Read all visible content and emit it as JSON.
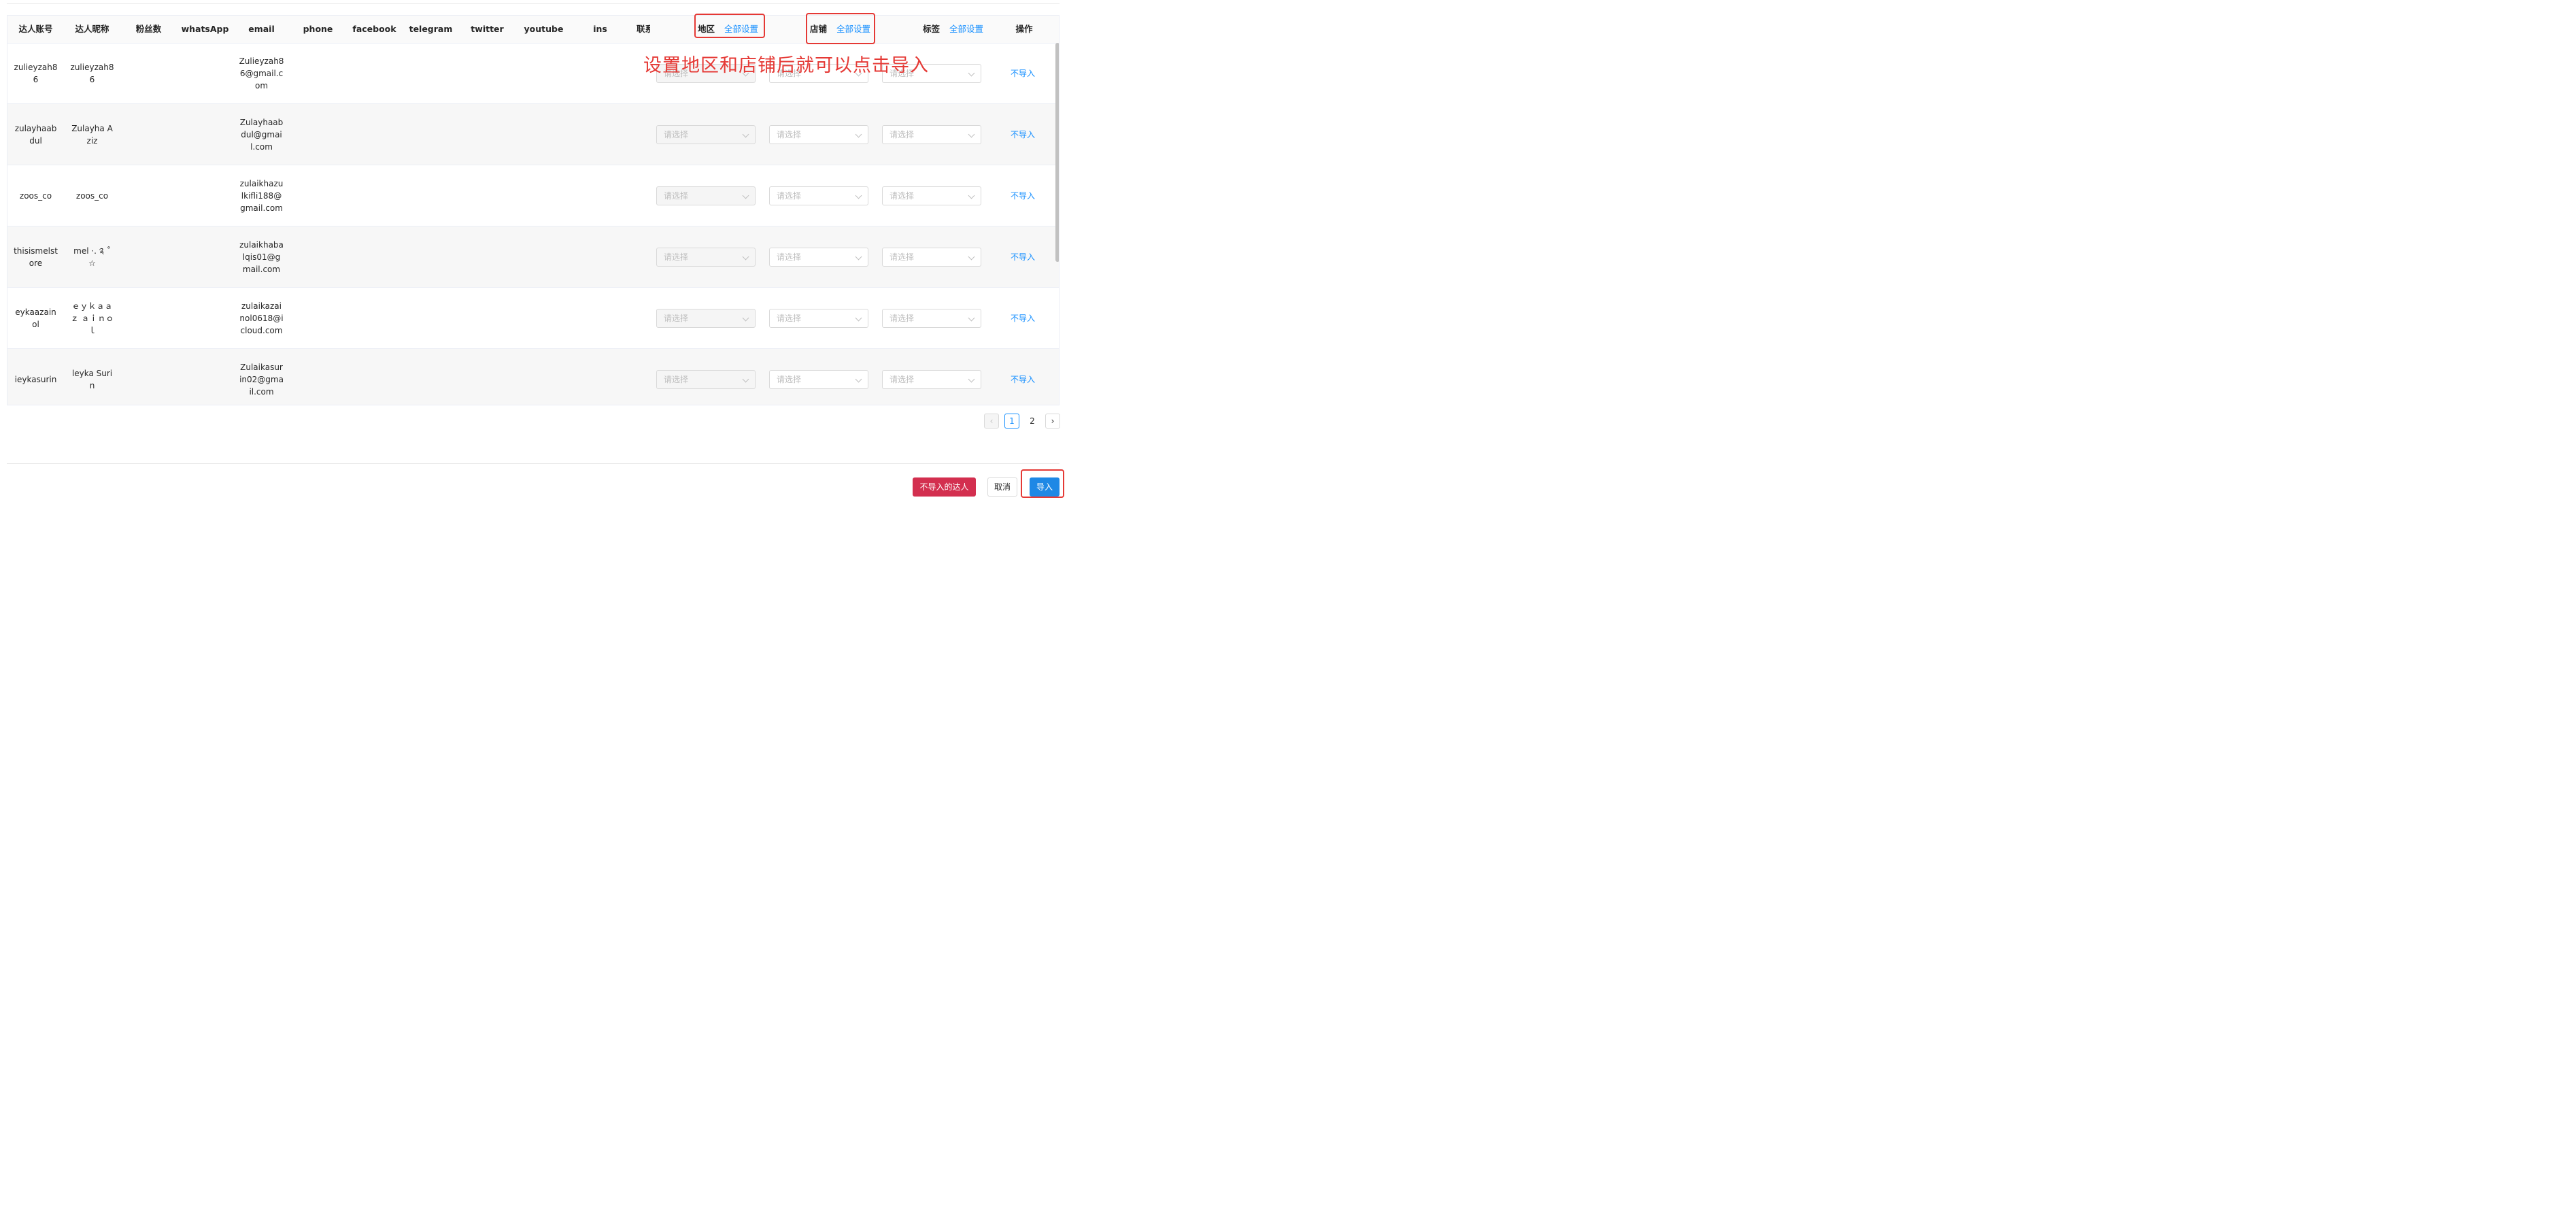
{
  "table": {
    "headers": {
      "account": "达人账号",
      "nickname": "达人昵称",
      "fans": "粉丝数",
      "whatsapp": "whatsApp",
      "email": "email",
      "phone": "phone",
      "facebook": "facebook",
      "telegram": "telegram",
      "twitter": "twitter",
      "youtube": "youtube",
      "ins": "ins",
      "contact": "联系",
      "region": "地区",
      "region_link": "全部设置",
      "store": "店铺",
      "store_link": "全部设置",
      "tag": "标签",
      "tag_link": "全部设置",
      "action": "操作"
    },
    "select_placeholder": "请选择",
    "row_action": "不导入",
    "rows": [
      {
        "account": "zulieyzah86",
        "nickname": "zulieyzah86",
        "email": "Zulieyzah86@gmail.com"
      },
      {
        "account": "zulayhaabdul",
        "nickname": "Zulayha Aziz",
        "email": "Zulayhaabdul@gmail.com"
      },
      {
        "account": "zoos_co",
        "nickname": "zoos_co",
        "email": "zulaikhazulkifli188@gmail.com"
      },
      {
        "account": "thisismelstore",
        "nickname": "mel ·. ༉ ˚ ☆",
        "email": "zulaikhabalqis01@gmail.com"
      },
      {
        "account": "eykaazainol",
        "nickname": "ｅｙｋａａｚ ａｉｎｏｌ",
        "email": "zulaikazainol0618@icloud.com"
      },
      {
        "account": "ieykasurin",
        "nickname": "leyka Surin",
        "email": "Zulaikasurin02@gmail.com"
      }
    ]
  },
  "annotation": {
    "text": "设置地区和店铺后就可以点击导入",
    "color": "#e53935"
  },
  "pagination": {
    "prev": "‹",
    "next": "›",
    "pages": [
      "1",
      "2"
    ],
    "current": "1"
  },
  "footer": {
    "skip_label": "不导入的达人",
    "cancel_label": "取消",
    "import_label": "导入"
  },
  "colors": {
    "primary": "#1890ff",
    "danger": "#d32f4f"
  }
}
